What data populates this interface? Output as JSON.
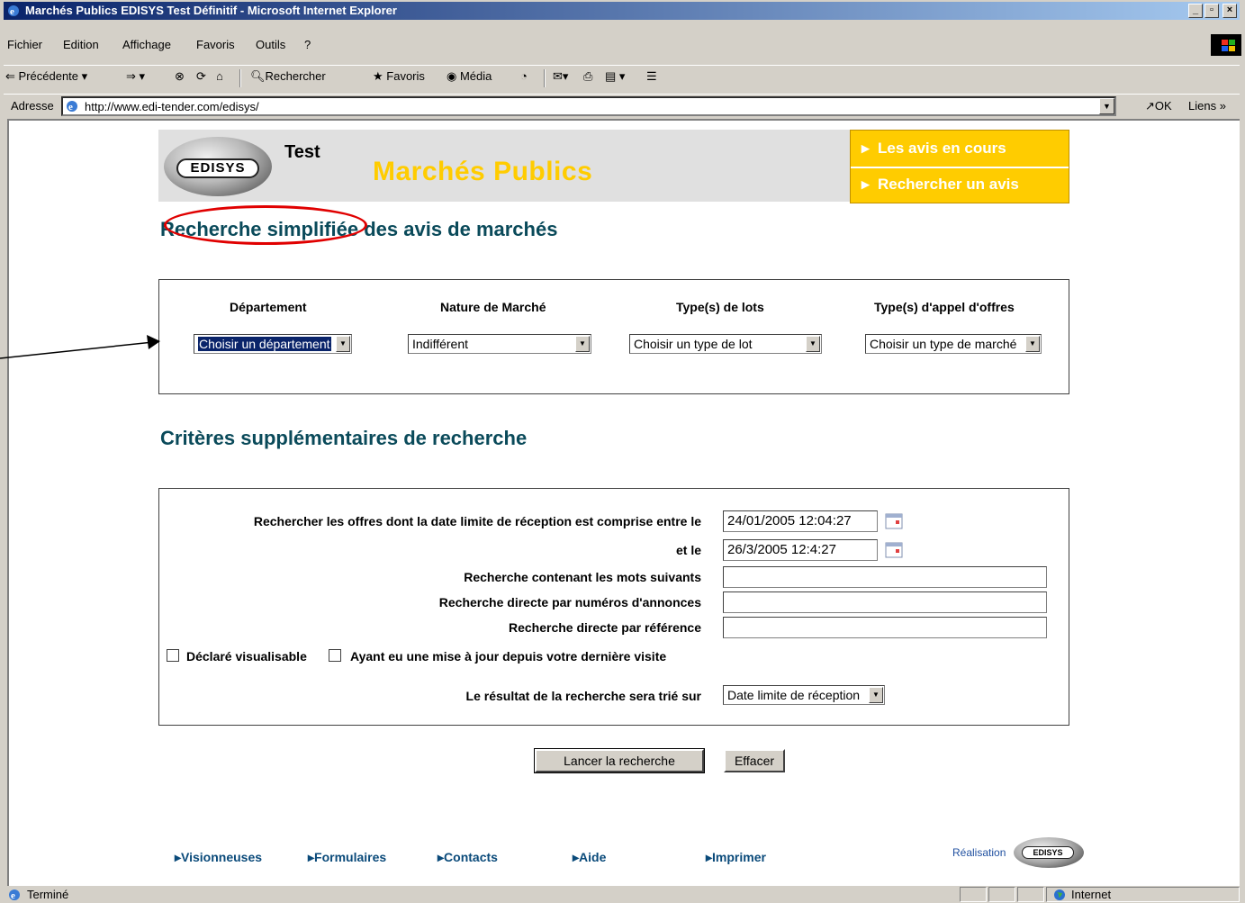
{
  "window": {
    "title": "Marchés Publics EDISYS Test Définitif - Microsoft Internet Explorer",
    "controls": [
      "_",
      "▫",
      "×"
    ]
  },
  "menubar": [
    "Fichier",
    "Edition",
    "Affichage",
    "Favoris",
    "Outils",
    "?"
  ],
  "toolbar": {
    "back": "Précédente",
    "search": "Rechercher",
    "favorites": "Favoris",
    "media": "Média"
  },
  "addressbar": {
    "label": "Adresse",
    "url": "http://www.edi-tender.com/edisys/",
    "go": "OK",
    "links": "Liens »"
  },
  "header": {
    "logo_text": "EDISYS",
    "test_label": "Test",
    "site_title": "Marchés Publics",
    "nav": [
      "Les avis en cours",
      "Rechercher un avis"
    ]
  },
  "simple_search": {
    "title": "Recherche simplifiée des avis de marchés",
    "columns": [
      {
        "label": "Département",
        "value": "Choisir un département"
      },
      {
        "label": "Nature de Marché",
        "value": "Indifférent"
      },
      {
        "label": "Type(s) de lots",
        "value": "Choisir un type de lot"
      },
      {
        "label": "Type(s) d'appel d'offres",
        "value": "Choisir un type de marché"
      }
    ]
  },
  "extra_criteria": {
    "title": "Critères supplémentaires de recherche",
    "date_from_label": "Rechercher les offres dont la date limite de réception est comprise entre le",
    "date_from": "24/01/2005 12:04:27",
    "date_to_label": "et le",
    "date_to": "26/3/2005 12:4:27",
    "keywords_label": "Recherche contenant les mots suivants",
    "keywords": "",
    "numbers_label": "Recherche directe par numéros d'annonces",
    "numbers": "",
    "reference_label": "Recherche directe par référence",
    "reference": "",
    "check1": "Déclaré visualisable",
    "check2": "Ayant eu une mise à jour depuis votre dernière visite",
    "sort_label": "Le résultat de la recherche sera trié sur",
    "sort_value": "Date limite de réception"
  },
  "buttons": {
    "search": "Lancer la recherche",
    "clear": "Effacer"
  },
  "footer": {
    "links": [
      "Visionneuses",
      "Formulaires",
      "Contacts",
      "Aide",
      "Imprimer"
    ],
    "credit": "Réalisation",
    "credit_logo": "EDISYS"
  },
  "statusbar": {
    "status": "Terminé",
    "zone": "Internet"
  },
  "colors": {
    "accent_yellow": "#ffcc00",
    "heading_teal": "#0a4a5a",
    "annotation_red": "#e00000"
  }
}
